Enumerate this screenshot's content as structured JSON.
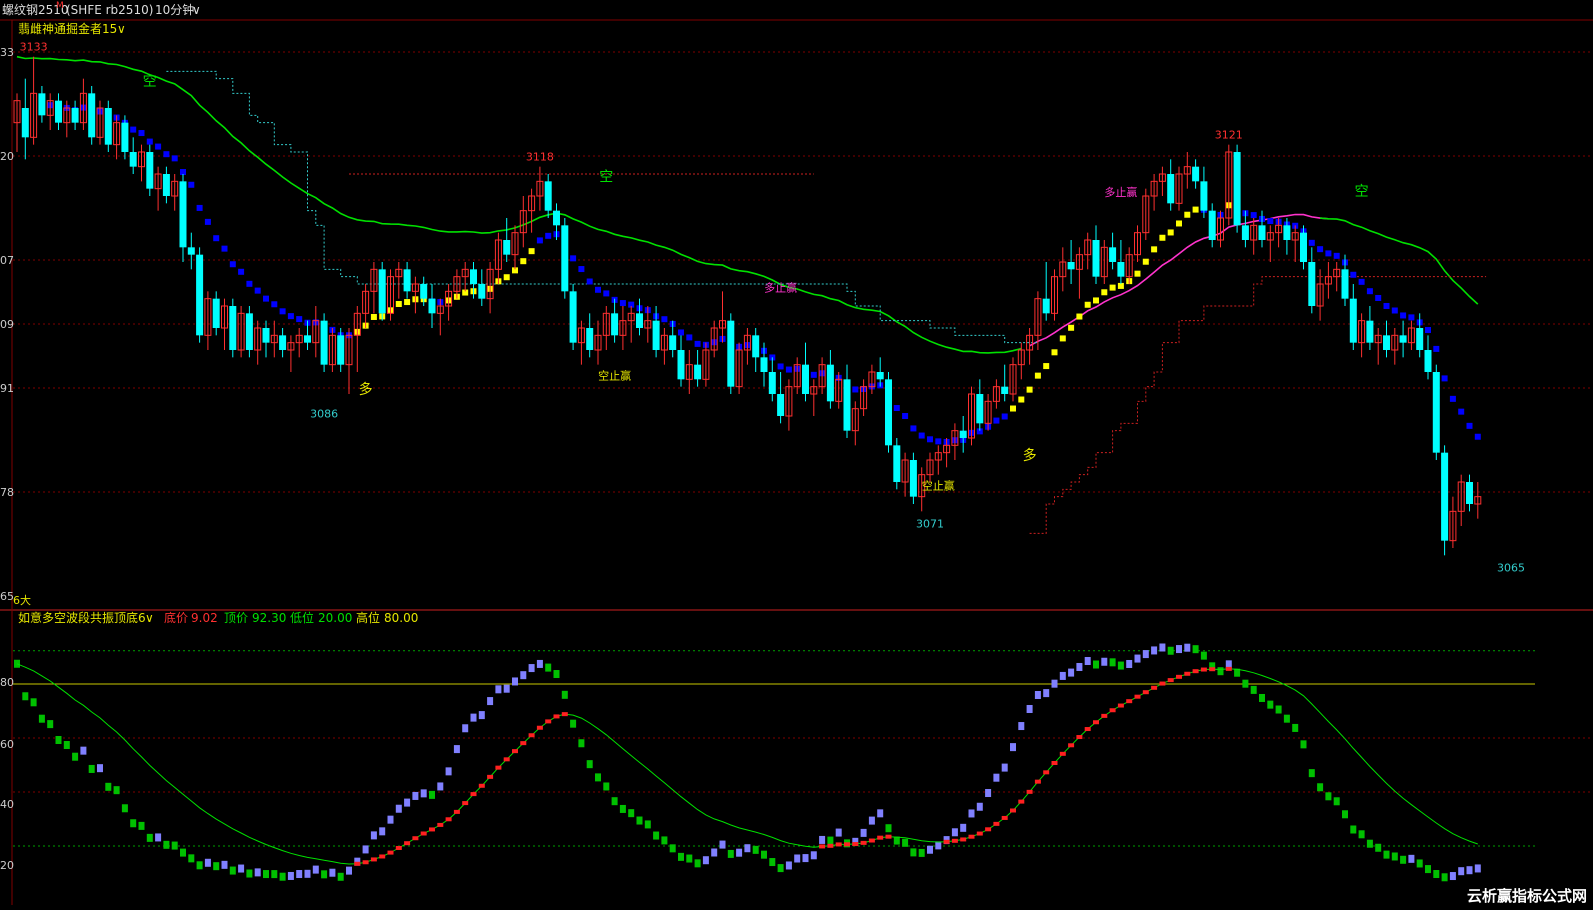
{
  "topbar": {
    "symbol": "螺纹钢2510",
    "sup": "M",
    "code": "(SHFE rb2510)",
    "period": "10分钟",
    "chev": "∨"
  },
  "main_panel": {
    "indicator_name": "翡雌神通掘金者15",
    "chev": "∨",
    "yticks": [
      "33",
      "20",
      "07",
      "09",
      "91",
      "78",
      "65"
    ],
    "corner_label": "6大"
  },
  "sub_panel": {
    "indicator_name": "如意多空波段共振顶底6",
    "chev": "∨",
    "legend": [
      {
        "label": "底价",
        "value": "9.02",
        "color": "#ff3030"
      },
      {
        "label": "顶价",
        "value": "92.30",
        "color": "#00e000"
      },
      {
        "label": "低位",
        "value": "20.00",
        "color": "#00e000"
      },
      {
        "label": "高位",
        "value": "80.00",
        "color": "#e6e600"
      }
    ],
    "yticks": [
      "80",
      "60",
      "40",
      "20"
    ]
  },
  "watermark": "云析赢指标公式网",
  "colors": {
    "up": "#ff3030",
    "down": "#00ffff",
    "ma_green": "#00e000",
    "ma_magenta": "#ff33cc",
    "step_down": "#0000ff",
    "step_up": "#ffff00",
    "osc_up": "#8080ff",
    "osc_down": "#00c000",
    "osc_signal_up": "#ff2020",
    "threshold": "#c8c800",
    "grid": "#800000"
  },
  "chart_data": [
    {
      "type": "candlestick",
      "title": "翡雌神通掘金者15",
      "ylim": [
        3060,
        3138
      ],
      "price_labels": [
        {
          "text": "3133",
          "value": 3133,
          "color": "#ff3030",
          "index": 2
        },
        {
          "text": "3118",
          "value": 3118,
          "color": "#ff3030",
          "index": 63
        },
        {
          "text": "3121",
          "value": 3121,
          "color": "#ff3030",
          "index": 146
        },
        {
          "text": "3086",
          "value": 3086,
          "color": "#33cccc",
          "index": 37
        },
        {
          "text": "3071",
          "value": 3071,
          "color": "#33cccc",
          "index": 110
        },
        {
          "text": "3065",
          "value": 3065,
          "color": "#33cccc",
          "index": 180
        }
      ],
      "signals": [
        {
          "text": "空",
          "index": 16,
          "value": 3129,
          "color": "#00e000"
        },
        {
          "text": "多",
          "index": 42,
          "value": 3087,
          "color": "#e6e600"
        },
        {
          "text": "空止赢",
          "index": 72,
          "value": 3089,
          "color": "#e6e600"
        },
        {
          "text": "空",
          "index": 71,
          "value": 3116,
          "color": "#00e000"
        },
        {
          "text": "多止赢",
          "index": 92,
          "value": 3101,
          "color": "#ff33cc"
        },
        {
          "text": "空止赢",
          "index": 111,
          "value": 3074,
          "color": "#e6e600"
        },
        {
          "text": "多",
          "index": 122,
          "value": 3078,
          "color": "#e6e600"
        },
        {
          "text": "多止赢",
          "index": 133,
          "value": 3114,
          "color": "#ff33cc"
        },
        {
          "text": "空",
          "index": 162,
          "value": 3114,
          "color": "#00e000"
        }
      ],
      "candles": [
        [
          3124,
          3128,
          3120,
          3127
        ],
        [
          3126,
          3130,
          3119,
          3122
        ],
        [
          3122,
          3133,
          3121,
          3128
        ],
        [
          3128,
          3129,
          3124,
          3125
        ],
        [
          3125,
          3128,
          3123,
          3127
        ],
        [
          3127,
          3128,
          3123,
          3124
        ],
        [
          3124,
          3127,
          3122,
          3126
        ],
        [
          3126,
          3127,
          3123,
          3124
        ],
        [
          3124,
          3130,
          3123,
          3128
        ],
        [
          3128,
          3129,
          3121,
          3122
        ],
        [
          3122,
          3127,
          3121,
          3126
        ],
        [
          3126,
          3127,
          3120,
          3121
        ],
        [
          3121,
          3125,
          3119,
          3124
        ],
        [
          3124,
          3125,
          3119,
          3120
        ],
        [
          3120,
          3122,
          3117,
          3118
        ],
        [
          3118,
          3121,
          3116,
          3120
        ],
        [
          3120,
          3121,
          3114,
          3115
        ],
        [
          3115,
          3118,
          3112,
          3117
        ],
        [
          3117,
          3118,
          3113,
          3114
        ],
        [
          3114,
          3117,
          3112,
          3116
        ],
        [
          3116,
          3117,
          3105,
          3107
        ],
        [
          3107,
          3109,
          3104,
          3106
        ],
        [
          3106,
          3107,
          3094,
          3095
        ],
        [
          3095,
          3101,
          3093,
          3100
        ],
        [
          3100,
          3101,
          3095,
          3096
        ],
        [
          3096,
          3100,
          3093,
          3099
        ],
        [
          3099,
          3100,
          3092,
          3093
        ],
        [
          3093,
          3099,
          3092,
          3098
        ],
        [
          3098,
          3099,
          3092,
          3093
        ],
        [
          3093,
          3097,
          3091,
          3096
        ],
        [
          3096,
          3097,
          3092,
          3094
        ],
        [
          3094,
          3097,
          3092,
          3095
        ],
        [
          3095,
          3096,
          3092,
          3093
        ],
        [
          3093,
          3095,
          3090,
          3094
        ],
        [
          3094,
          3096,
          3092,
          3095
        ],
        [
          3095,
          3097,
          3093,
          3094
        ],
        [
          3094,
          3099,
          3092,
          3097
        ],
        [
          3097,
          3098,
          3090,
          3091
        ],
        [
          3091,
          3096,
          3090,
          3095
        ],
        [
          3095,
          3096,
          3090,
          3091
        ],
        [
          3091,
          3096,
          3087,
          3095
        ],
        [
          3095,
          3099,
          3090,
          3098
        ],
        [
          3098,
          3102,
          3096,
          3101
        ],
        [
          3101,
          3105,
          3098,
          3104
        ],
        [
          3104,
          3105,
          3097,
          3098
        ],
        [
          3098,
          3104,
          3097,
          3103
        ],
        [
          3103,
          3105,
          3100,
          3104
        ],
        [
          3104,
          3105,
          3100,
          3101
        ],
        [
          3101,
          3103,
          3098,
          3102
        ],
        [
          3102,
          3103,
          3099,
          3100
        ],
        [
          3100,
          3102,
          3096,
          3098
        ],
        [
          3098,
          3100,
          3095,
          3099
        ],
        [
          3099,
          3102,
          3097,
          3101
        ],
        [
          3101,
          3104,
          3100,
          3103
        ],
        [
          3103,
          3105,
          3101,
          3104
        ],
        [
          3104,
          3105,
          3100,
          3102
        ],
        [
          3102,
          3104,
          3099,
          3100
        ],
        [
          3100,
          3105,
          3098,
          3104
        ],
        [
          3104,
          3109,
          3102,
          3108
        ],
        [
          3108,
          3111,
          3105,
          3106
        ],
        [
          3106,
          3110,
          3104,
          3109
        ],
        [
          3109,
          3114,
          3107,
          3112
        ],
        [
          3112,
          3115,
          3109,
          3114
        ],
        [
          3114,
          3118,
          3112,
          3116
        ],
        [
          3116,
          3117,
          3111,
          3112
        ],
        [
          3112,
          3113,
          3108,
          3110
        ],
        [
          3110,
          3111,
          3100,
          3101
        ],
        [
          3101,
          3102,
          3093,
          3094
        ],
        [
          3094,
          3097,
          3091,
          3096
        ],
        [
          3096,
          3098,
          3092,
          3093
        ],
        [
          3093,
          3097,
          3091,
          3095
        ],
        [
          3095,
          3099,
          3093,
          3098
        ],
        [
          3098,
          3100,
          3094,
          3095
        ],
        [
          3095,
          3099,
          3093,
          3097
        ],
        [
          3097,
          3099,
          3094,
          3098
        ],
        [
          3098,
          3100,
          3095,
          3096
        ],
        [
          3096,
          3099,
          3094,
          3097
        ],
        [
          3097,
          3099,
          3092,
          3093
        ],
        [
          3093,
          3096,
          3091,
          3095
        ],
        [
          3095,
          3097,
          3092,
          3093
        ],
        [
          3093,
          3095,
          3088,
          3089
        ],
        [
          3089,
          3093,
          3087,
          3091
        ],
        [
          3091,
          3093,
          3088,
          3089
        ],
        [
          3089,
          3094,
          3088,
          3093
        ],
        [
          3093,
          3097,
          3092,
          3096
        ],
        [
          3096,
          3101,
          3094,
          3097
        ],
        [
          3097,
          3098,
          3087,
          3088
        ],
        [
          3088,
          3094,
          3087,
          3093
        ],
        [
          3093,
          3096,
          3091,
          3095
        ],
        [
          3095,
          3096,
          3090,
          3092
        ],
        [
          3092,
          3094,
          3088,
          3090
        ],
        [
          3090,
          3092,
          3086,
          3087
        ],
        [
          3087,
          3090,
          3083,
          3084
        ],
        [
          3084,
          3089,
          3082,
          3088
        ],
        [
          3088,
          3092,
          3087,
          3091
        ],
        [
          3091,
          3094,
          3086,
          3087
        ],
        [
          3087,
          3089,
          3084,
          3088
        ],
        [
          3088,
          3092,
          3087,
          3091
        ],
        [
          3091,
          3093,
          3085,
          3086
        ],
        [
          3086,
          3090,
          3085,
          3089
        ],
        [
          3089,
          3091,
          3081,
          3082
        ],
        [
          3082,
          3086,
          3080,
          3085
        ],
        [
          3085,
          3089,
          3084,
          3088
        ],
        [
          3088,
          3091,
          3087,
          3090
        ],
        [
          3090,
          3092,
          3088,
          3089
        ],
        [
          3089,
          3090,
          3079,
          3080
        ],
        [
          3080,
          3081,
          3074,
          3075
        ],
        [
          3075,
          3079,
          3073,
          3078
        ],
        [
          3078,
          3079,
          3072,
          3073
        ],
        [
          3073,
          3077,
          3071,
          3076
        ],
        [
          3076,
          3079,
          3075,
          3078
        ],
        [
          3078,
          3080,
          3076,
          3079
        ],
        [
          3079,
          3081,
          3077,
          3080
        ],
        [
          3080,
          3083,
          3078,
          3082
        ],
        [
          3082,
          3084,
          3079,
          3081
        ],
        [
          3081,
          3088,
          3080,
          3087
        ],
        [
          3087,
          3089,
          3082,
          3083
        ],
        [
          3083,
          3087,
          3082,
          3086
        ],
        [
          3086,
          3089,
          3085,
          3088
        ],
        [
          3088,
          3091,
          3086,
          3087
        ],
        [
          3087,
          3092,
          3086,
          3091
        ],
        [
          3091,
          3094,
          3089,
          3093
        ],
        [
          3093,
          3096,
          3091,
          3095
        ],
        [
          3095,
          3101,
          3093,
          3100
        ],
        [
          3100,
          3105,
          3097,
          3098
        ],
        [
          3098,
          3104,
          3097,
          3103
        ],
        [
          3103,
          3107,
          3101,
          3105
        ],
        [
          3105,
          3108,
          3102,
          3104
        ],
        [
          3104,
          3107,
          3100,
          3106
        ],
        [
          3106,
          3109,
          3104,
          3108
        ],
        [
          3108,
          3110,
          3102,
          3103
        ],
        [
          3103,
          3108,
          3102,
          3107
        ],
        [
          3107,
          3109,
          3104,
          3105
        ],
        [
          3105,
          3108,
          3102,
          3103
        ],
        [
          3103,
          3107,
          3102,
          3106
        ],
        [
          3106,
          3110,
          3105,
          3109
        ],
        [
          3109,
          3115,
          3108,
          3114
        ],
        [
          3114,
          3117,
          3112,
          3116
        ],
        [
          3116,
          3118,
          3114,
          3117
        ],
        [
          3117,
          3119,
          3112,
          3113
        ],
        [
          3113,
          3118,
          3112,
          3117
        ],
        [
          3117,
          3120,
          3115,
          3118
        ],
        [
          3118,
          3119,
          3115,
          3116
        ],
        [
          3116,
          3118,
          3111,
          3112
        ],
        [
          3112,
          3113,
          3107,
          3108
        ],
        [
          3108,
          3112,
          3107,
          3111
        ],
        [
          3111,
          3121,
          3110,
          3120
        ],
        [
          3120,
          3121,
          3109,
          3110
        ],
        [
          3110,
          3112,
          3107,
          3108
        ],
        [
          3108,
          3111,
          3106,
          3110
        ],
        [
          3110,
          3112,
          3107,
          3108
        ],
        [
          3108,
          3110,
          3105,
          3109
        ],
        [
          3109,
          3111,
          3107,
          3110
        ],
        [
          3110,
          3111,
          3106,
          3108
        ],
        [
          3108,
          3110,
          3105,
          3109
        ],
        [
          3109,
          3110,
          3104,
          3105
        ],
        [
          3105,
          3107,
          3098,
          3099
        ],
        [
          3099,
          3104,
          3097,
          3102
        ],
        [
          3102,
          3105,
          3100,
          3103
        ],
        [
          3103,
          3105,
          3101,
          3104
        ],
        [
          3104,
          3106,
          3099,
          3100
        ],
        [
          3100,
          3102,
          3093,
          3094
        ],
        [
          3094,
          3098,
          3092,
          3097
        ],
        [
          3097,
          3099,
          3093,
          3094
        ],
        [
          3094,
          3096,
          3091,
          3095
        ],
        [
          3095,
          3097,
          3092,
          3093
        ],
        [
          3093,
          3096,
          3091,
          3095
        ],
        [
          3095,
          3097,
          3092,
          3094
        ],
        [
          3094,
          3097,
          3093,
          3096
        ],
        [
          3096,
          3098,
          3092,
          3093
        ],
        [
          3093,
          3095,
          3089,
          3090
        ],
        [
          3090,
          3091,
          3078,
          3079
        ],
        [
          3079,
          3080,
          3065,
          3067
        ],
        [
          3067,
          3073,
          3066,
          3071
        ],
        [
          3071,
          3076,
          3069,
          3075
        ],
        [
          3075,
          3076,
          3071,
          3072
        ],
        [
          3072,
          3075,
          3070,
          3073
        ]
      ]
    },
    {
      "type": "oscillator",
      "title": "如意多空波段共振顶底6",
      "ylim": [
        0,
        100
      ],
      "levels": {
        "底价": 9.02,
        "顶价": 92.3,
        "低位": 20,
        "高位": 80
      }
    }
  ]
}
